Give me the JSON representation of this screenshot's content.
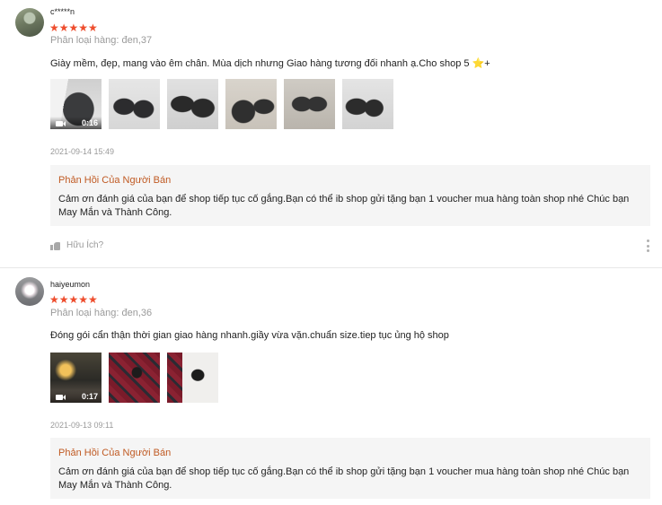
{
  "reviews": [
    {
      "username": "c*****n",
      "stars": "★★★★★",
      "variant": "Phân loại hàng: đen,37",
      "comment": "Giày mềm, đẹp, mang vào êm chân. Mùa dịch nhưng Giao hàng tương đối nhanh ạ.Cho shop 5 ⭐+",
      "video_duration": "0:16",
      "timestamp": "2021-09-14 15:49",
      "reply_title": "Phản Hồi Của Người Bán",
      "reply_text": "Cảm ơn đánh giá của bạn để shop tiếp tục cố gắng.Bạn có thể ib shop gửi tặng bạn 1 voucher mua hàng toàn shop nhé Chúc bạn May Mắn và Thành Công.",
      "helpful_label": "Hữu Ích?"
    },
    {
      "username": "haiyeumon",
      "stars": "★★★★★",
      "variant": "Phân loại hàng: đen,36",
      "comment": "Đóng gói cẩn thận thời gian giao hàng nhanh.giầy vừa vặn.chuẩn size.tiep tục ủng hộ shop",
      "video_duration": "0:17",
      "timestamp": "2021-09-13 09:11",
      "reply_title": "Phản Hồi Của Người Bán",
      "reply_text": "Cảm ơn đánh giá của bạn để shop tiếp tục cố gắng.Bạn có thể ib shop gửi tặng bạn 1 voucher mua hàng toàn shop nhé Chúc bạn May Mắn và Thành Công."
    }
  ],
  "colors": {
    "star": "#ee4d2d",
    "reply_title": "#c05a23",
    "reply_bg": "#f5f5f5",
    "muted_text": "#9a9a9a"
  },
  "icons": [
    "video-icon",
    "thumbs-up-icon",
    "more-options-icon"
  ]
}
